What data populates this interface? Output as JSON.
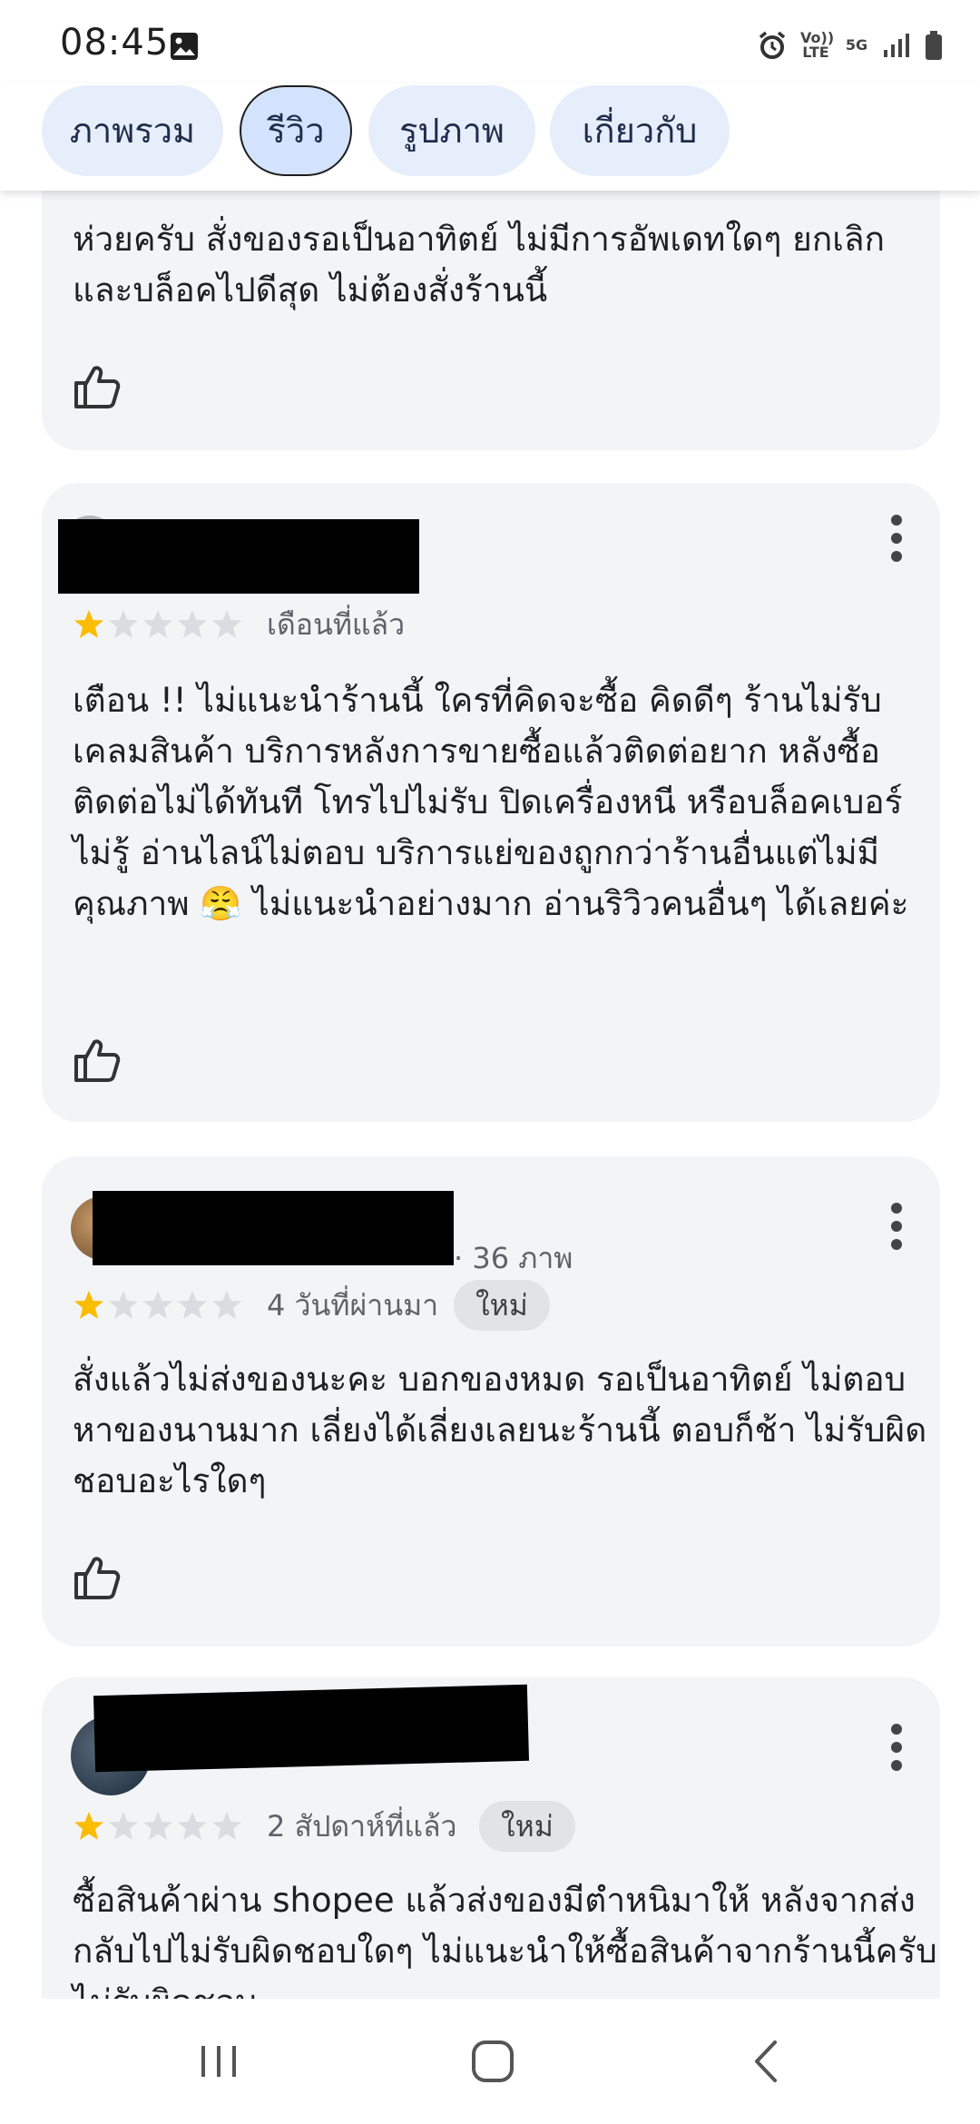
{
  "status_bar": {
    "time": "08:45",
    "network_volte": "Vo)) LTE",
    "network_5g": "5G"
  },
  "tabs": [
    {
      "label": "ภาพรวม",
      "active": false
    },
    {
      "label": "รีวิว",
      "active": true
    },
    {
      "label": "รูปภาพ",
      "active": false
    },
    {
      "label": "เกี่ยวกับ",
      "active": false
    }
  ],
  "reviews": [
    {
      "text": "ห่วยครับ สั่งของรอเป็นอาทิตย์ ไม่มีการอัพเดทใดๆ ยกเลิกและบล็อคไปดีสุด ไม่ต้องสั่งร้านนี้"
    },
    {
      "rating": 1,
      "time": "เดือนที่แล้ว",
      "text": "เตือน !! ไม่แนะนำร้านนี้ ใครที่คิดจะซื้อ คิดดีๆ ร้านไม่รับเคลมสินค้า บริการหลังการขายซื้อแล้วติดต่อยาก หลังซื้อติดต่อไม่ได้ทันที โทรไปไม่รับ ปิดเครื่องหนี หรือบล็อคเบอร์ไม่รู้ อ่านไลน์ไม่ตอบ บริการแย่ของถูกกว่าร้านอื่นแต่ไม่มีคุณภาพ 😤 ไม่แนะนำอย่างมาก อ่านริวิวคนอื่นๆ ได้เลยค่ะ"
    },
    {
      "rating": 1,
      "photos": "· 36 ภาพ",
      "time": "4 วันที่ผ่านมา",
      "badge": "ใหม่",
      "text": "สั่งแล้วไม่ส่งของนะคะ บอกของหมด รอเป็นอาทิตย์ ไม่ตอบ หาของนานมาก เลี่ยงได้เลี่ยงเลยนะร้านนี้ ตอบก็ช้า ไม่รับผิดชอบอะไรใดๆ"
    },
    {
      "rating": 1,
      "time": "2 สัปดาห์ที่แล้ว",
      "badge": "ใหม่",
      "text": "ซื้อสินค้าผ่าน shopee แล้วส่งของมีตำหนิมาให้ หลังจากส่งกลับไปไม่รับผิดชอบใดๆ ไม่แนะนำให้ซื้อสินค้าจากร้านนี้ครับ ไม่รับผิดชอบ"
    }
  ],
  "colors": {
    "star_filled": "#fbbc04",
    "star_empty": "#dadce0",
    "card_bg": "#f3f4f6",
    "tab_bg": "#e6edfb",
    "tab_active_bg": "#d3e3fd"
  }
}
